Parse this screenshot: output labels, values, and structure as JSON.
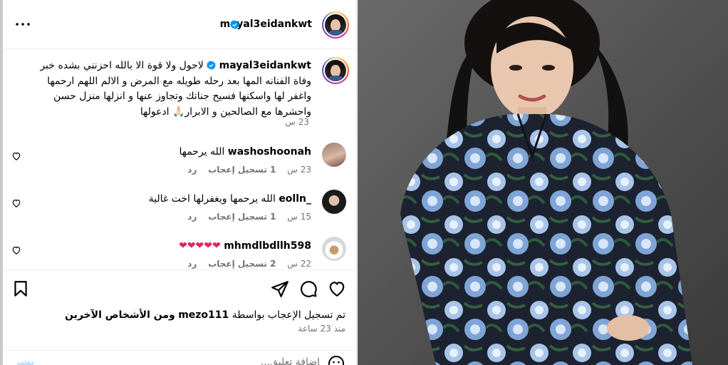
{
  "post": {
    "username": "mayal3eidankwt",
    "more_label": "..."
  },
  "caption": {
    "username": "mayal3eidankwt",
    "text": "لاحول ولا قوة الا بالله احزنني بشده خبر وفاة الفنانه المها بعد رحله طويله مع المرض و الالم اللهم ارحمها واغفر لها واسكنها فسيح جناتك وتجاوز عنها و انزلها منزل حسن واحشرها مع الصالحين و الابرار🙏🏻 ادعولها",
    "time": "23 س"
  },
  "comments": [
    {
      "username": "washoshoonah",
      "text": "الله يرحمها",
      "time": "23 س",
      "likes": "1 تسجيل إعجاب",
      "reply": "رد"
    },
    {
      "username": "eolln_",
      "text": "الله يرحمها ويغفرلها اخت غالية",
      "time": "15 س",
      "likes": "1 تسجيل إعجاب",
      "reply": "رد"
    },
    {
      "username": "mhmdlbdllh598",
      "text": "❤❤❤❤❤",
      "time": "22 س",
      "likes": "2 تسجيل إعجاب",
      "reply": "رد"
    }
  ],
  "actions": {
    "likes_prefix": "تم تسجيل الإعجاب بواسطة",
    "likes_user": "mezo111",
    "likes_others": "ومن الأشخاص الآخرين",
    "time": "منذ 23 ساعة"
  },
  "comment_box": {
    "placeholder": "إضافة تعليق...",
    "post_label": "نشر"
  },
  "colors": {
    "verified": "#0095f6",
    "muted": "#737373",
    "heart": "#e0245e"
  },
  "icons": [
    "more-icon",
    "verified-icon",
    "heart-icon",
    "comment-icon",
    "share-icon",
    "save-icon",
    "emoji-icon"
  ]
}
